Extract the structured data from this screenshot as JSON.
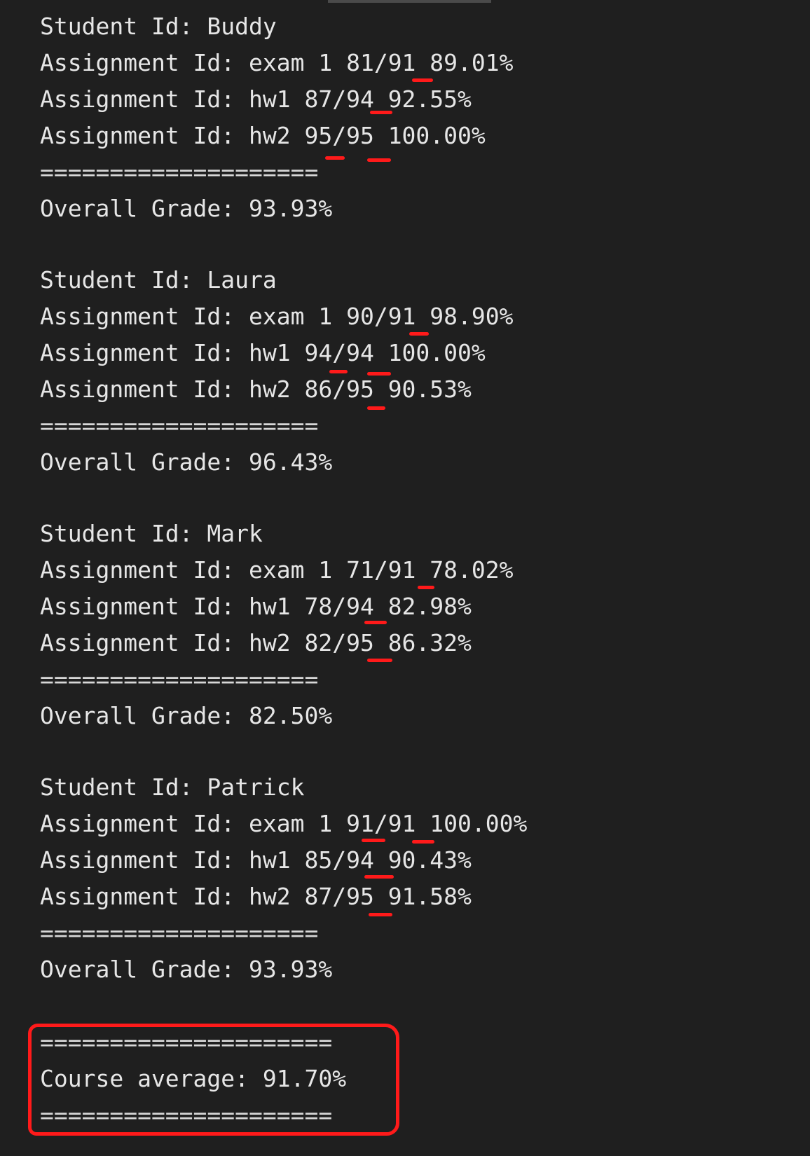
{
  "students": [
    {
      "header": "Student Id: Buddy",
      "assignments": [
        "Assignment Id: exam 1 81/91 89.01%",
        "Assignment Id: hw1 87/94 92.55%",
        "Assignment Id: hw2 95/95 100.00%"
      ],
      "separator": "====================",
      "overall": "Overall Grade: 93.93%"
    },
    {
      "header": "Student Id: Laura",
      "assignments": [
        "Assignment Id: exam 1 90/91 98.90%",
        "Assignment Id: hw1 94/94 100.00%",
        "Assignment Id: hw2 86/95 90.53%"
      ],
      "separator": "====================",
      "overall": "Overall Grade: 96.43%"
    },
    {
      "header": "Student Id: Mark",
      "assignments": [
        "Assignment Id: exam 1 71/91 78.02%",
        "Assignment Id: hw1 78/94 82.98%",
        "Assignment Id: hw2 82/95 86.32%"
      ],
      "separator": "====================",
      "overall": "Overall Grade: 82.50%"
    },
    {
      "header": "Student Id: Patrick",
      "assignments": [
        "Assignment Id: exam 1 91/91 100.00%",
        "Assignment Id: hw1 85/94 90.43%",
        "Assignment Id: hw2 87/95 91.58%"
      ],
      "separator": "====================",
      "overall": "Overall Grade: 93.93%"
    }
  ],
  "course": {
    "separator_top": "=====================",
    "average": "Course average: 91.70%",
    "separator_bottom": "====================="
  },
  "annotation_color": "#ff1a1a"
}
